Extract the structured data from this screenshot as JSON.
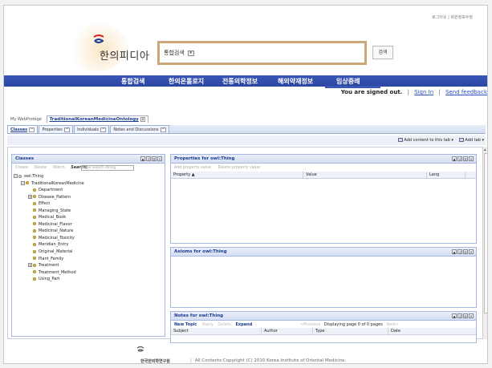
{
  "util_links": "로그아웃 | 회원정보수정",
  "logo": {
    "text": "한의피디아"
  },
  "search": {
    "select_value": "통합검색",
    "button": "검색"
  },
  "nav": [
    "통합검색",
    "한의온톨로지",
    "전통의학정보",
    "해외약재정보",
    "임상증례"
  ],
  "signin": {
    "status": "You are signed out.",
    "sign_in": "Sign In",
    "separator": "|",
    "feedback": "Send feedback"
  },
  "project_tabs": [
    {
      "label": "My WebProtégé",
      "active": false
    },
    {
      "label": "TraditionalKoreanMedicineOntology",
      "active": true,
      "close": "x"
    }
  ],
  "sub_tabs": [
    {
      "label": "Classes",
      "active": true
    },
    {
      "label": "Properties",
      "active": false
    },
    {
      "label": "Individuals",
      "active": false
    },
    {
      "label": "Notes and Discussions",
      "active": false
    }
  ],
  "toolbar": {
    "add_content": "Add content to this tab ▾",
    "add_tab": "Add tab ▾"
  },
  "classes_panel": {
    "title": "Classes",
    "tools": [
      "Create",
      "Delete",
      "Watch"
    ],
    "search_label": "Search:",
    "search_placeholder": "Type search string",
    "tree": [
      {
        "label": "owl:Thing",
        "level": 0,
        "toggle": "−",
        "root": true
      },
      {
        "label": "TraditionalKoreanMedicine",
        "level": 1,
        "toggle": "−"
      },
      {
        "label": "Department",
        "level": 2,
        "toggle": ""
      },
      {
        "label": "Disease_Pattern",
        "level": 2,
        "toggle": "+"
      },
      {
        "label": "Effect",
        "level": 2,
        "toggle": ""
      },
      {
        "label": "Managing_State",
        "level": 2,
        "toggle": ""
      },
      {
        "label": "Medical_Book",
        "level": 2,
        "toggle": ""
      },
      {
        "label": "Medicinal_Flavor",
        "level": 2,
        "toggle": ""
      },
      {
        "label": "Medicinal_Nature",
        "level": 2,
        "toggle": ""
      },
      {
        "label": "Medicinal_Toxicity",
        "level": 2,
        "toggle": ""
      },
      {
        "label": "Meridian_Entry",
        "level": 2,
        "toggle": ""
      },
      {
        "label": "Original_Material",
        "level": 2,
        "toggle": ""
      },
      {
        "label": "Plant_Family",
        "level": 2,
        "toggle": ""
      },
      {
        "label": "Treatment",
        "level": 2,
        "toggle": "+"
      },
      {
        "label": "Treatment_Method",
        "level": 2,
        "toggle": ""
      },
      {
        "label": "Using_Part",
        "level": 2,
        "toggle": ""
      }
    ]
  },
  "properties_panel": {
    "title": "Properties for owl:Thing",
    "tools": [
      "Add property value",
      "Delete property value"
    ],
    "columns": [
      "Property ▲",
      "Value",
      "Lang"
    ]
  },
  "axioms_panel": {
    "title": "Axioms for owl:Thing"
  },
  "notes_panel": {
    "title": "Notes for owl:Thing",
    "new_topic": "New Topic",
    "reply": "Reply",
    "delete": "Delete",
    "expand": "Expand",
    "prev": "<Previous",
    "paging": "Displaying page 0 of 0 pages",
    "next": "Next>",
    "columns": [
      "Subject",
      "Author",
      "Type",
      "Date"
    ]
  },
  "panel_controls": [
    "▲",
    "↺",
    "⚙",
    "✕"
  ],
  "footer": {
    "org": "한국한의학연구원",
    "copyright": "All Contents Copyright (C) 2010 Korea Institute of Oriental Medicine."
  },
  "colors": {
    "nav_blue": "#2a45a2",
    "search_border": "#c9a776",
    "link_blue": "#2a52be",
    "tree_dot": "#e8b84a"
  }
}
